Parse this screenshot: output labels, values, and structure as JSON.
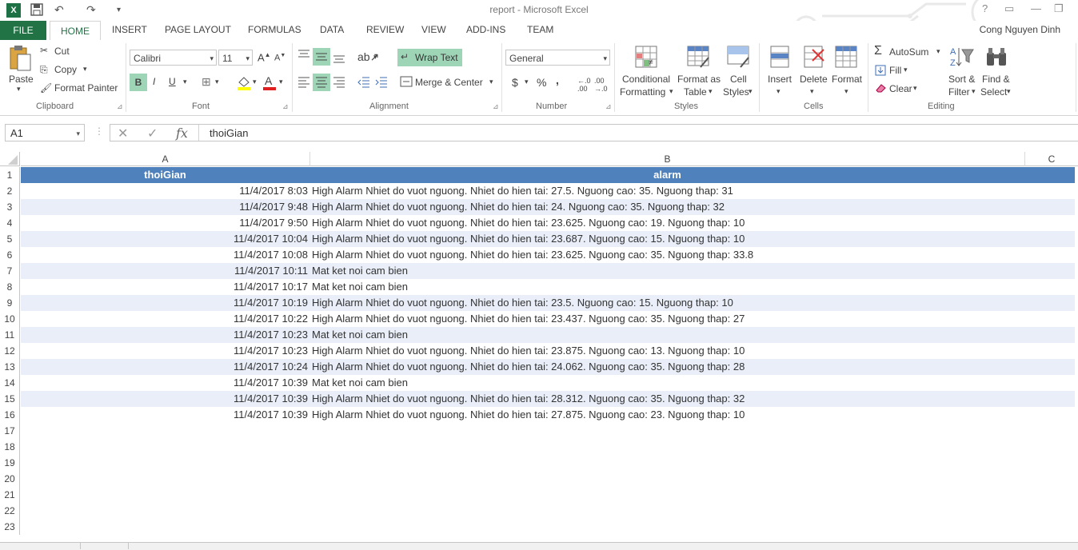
{
  "window": {
    "title": "report - Microsoft Excel",
    "app_logo": "X",
    "user": "Cong Nguyen Dinh"
  },
  "tabs": {
    "file": "FILE",
    "home": "HOME",
    "items": [
      "INSERT",
      "PAGE LAYOUT",
      "FORMULAS",
      "DATA",
      "REVIEW",
      "VIEW",
      "ADD-INS",
      "TEAM"
    ]
  },
  "ribbon": {
    "clipboard": {
      "paste": "Paste",
      "cut": "Cut",
      "copy": "Copy",
      "format_painter": "Format Painter",
      "label": "Clipboard"
    },
    "font": {
      "name": "Calibri",
      "size": "11",
      "bold": "B",
      "italic": "I",
      "underline": "U",
      "label": "Font"
    },
    "alignment": {
      "wrap_text": "Wrap Text",
      "merge_center": "Merge & Center",
      "label": "Alignment"
    },
    "number": {
      "format": "General",
      "currency": "$",
      "percent": "%",
      "comma": ",",
      "label": "Number"
    },
    "styles": {
      "conditional1": "Conditional",
      "conditional2": "Formatting",
      "format_as1": "Format as",
      "format_as2": "Table",
      "cell1": "Cell",
      "cell2": "Styles",
      "label": "Styles"
    },
    "cells": {
      "insert": "Insert",
      "delete": "Delete",
      "format": "Format",
      "label": "Cells"
    },
    "editing": {
      "autosum": "AutoSum",
      "fill": "Fill",
      "clear": "Clear",
      "sort1": "Sort &",
      "sort2": "Filter",
      "find1": "Find &",
      "find2": "Select",
      "label": "Editing"
    }
  },
  "formula_bar": {
    "name_box": "A1",
    "fx": "fx",
    "value": "thoiGian"
  },
  "sheet": {
    "columns": [
      "A",
      "B",
      "C"
    ],
    "header_color": "#4f81bd",
    "band_color": "#e9eef8",
    "header": {
      "row": "1",
      "a": "thoiGian",
      "b": "alarm"
    },
    "rows": [
      {
        "n": "2",
        "a": "11/4/2017 8:03",
        "b": "High Alarm Nhiet do vuot nguong. Nhiet do hien tai: 27.5. Nguong cao: 35. Nguong thap: 31"
      },
      {
        "n": "3",
        "a": "11/4/2017 9:48",
        "b": "High Alarm Nhiet do vuot nguong. Nhiet do hien tai: 24. Nguong cao: 35. Nguong thap: 32"
      },
      {
        "n": "4",
        "a": "11/4/2017 9:50",
        "b": "High Alarm Nhiet do vuot nguong. Nhiet do hien tai: 23.625. Nguong cao: 19. Nguong thap: 10"
      },
      {
        "n": "5",
        "a": "11/4/2017 10:04",
        "b": "High Alarm Nhiet do vuot nguong. Nhiet do hien tai: 23.687. Nguong cao: 15. Nguong thap: 10"
      },
      {
        "n": "6",
        "a": "11/4/2017 10:08",
        "b": "High Alarm Nhiet do vuot nguong. Nhiet do hien tai: 23.625. Nguong cao: 35. Nguong thap: 33.8"
      },
      {
        "n": "7",
        "a": "11/4/2017 10:11",
        "b": "Mat ket noi cam bien"
      },
      {
        "n": "8",
        "a": "11/4/2017 10:17",
        "b": "Mat ket noi cam bien"
      },
      {
        "n": "9",
        "a": "11/4/2017 10:19",
        "b": "High Alarm Nhiet do vuot nguong. Nhiet do hien tai: 23.5. Nguong cao: 15. Nguong thap: 10"
      },
      {
        "n": "10",
        "a": "11/4/2017 10:22",
        "b": "High Alarm Nhiet do vuot nguong. Nhiet do hien tai: 23.437. Nguong cao: 35. Nguong thap: 27"
      },
      {
        "n": "11",
        "a": "11/4/2017 10:23",
        "b": "Mat ket noi cam bien"
      },
      {
        "n": "12",
        "a": "11/4/2017 10:23",
        "b": "High Alarm Nhiet do vuot nguong. Nhiet do hien tai: 23.875. Nguong cao: 13. Nguong thap: 10"
      },
      {
        "n": "13",
        "a": "11/4/2017 10:24",
        "b": "High Alarm Nhiet do vuot nguong. Nhiet do hien tai: 24.062. Nguong cao: 35. Nguong thap: 28"
      },
      {
        "n": "14",
        "a": "11/4/2017 10:39",
        "b": "Mat ket noi cam bien"
      },
      {
        "n": "15",
        "a": "11/4/2017 10:39",
        "b": "High Alarm Nhiet do vuot nguong. Nhiet do hien tai: 28.312. Nguong cao: 35. Nguong thap: 32"
      },
      {
        "n": "16",
        "a": "11/4/2017 10:39",
        "b": "High Alarm Nhiet do vuot nguong. Nhiet do hien tai: 27.875. Nguong cao: 23. Nguong thap: 10"
      }
    ],
    "empty_rows": [
      "17",
      "18",
      "19",
      "20",
      "21",
      "22",
      "23"
    ]
  }
}
